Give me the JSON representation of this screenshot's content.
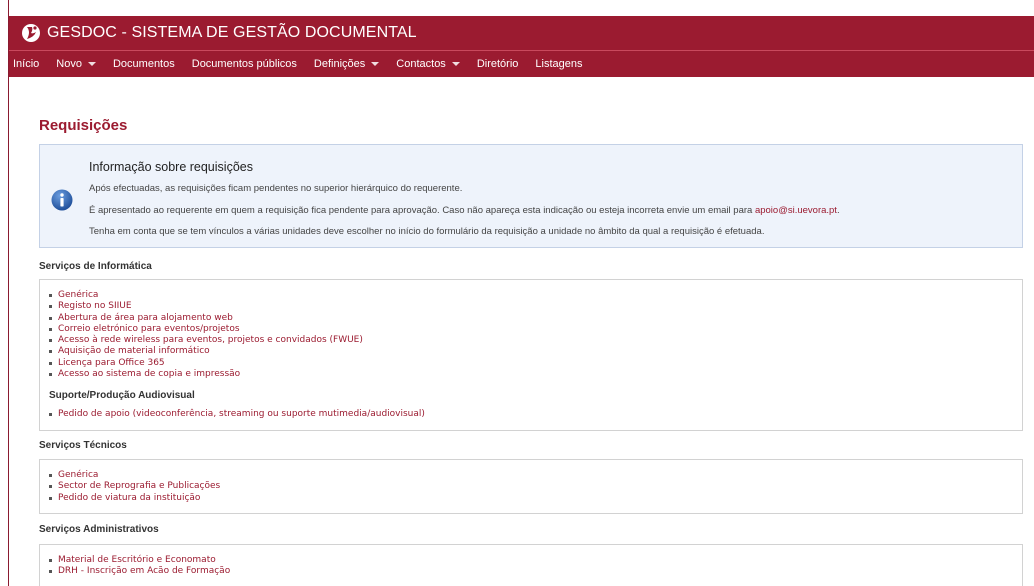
{
  "app": {
    "title": "GESDOC - SISTEMA DE GESTÃO DOCUMENTAL"
  },
  "nav": {
    "items": [
      {
        "label": "Início",
        "dropdown": false
      },
      {
        "label": "Novo",
        "dropdown": true
      },
      {
        "label": "Documentos",
        "dropdown": false
      },
      {
        "label": "Documentos públicos",
        "dropdown": false
      },
      {
        "label": "Definições",
        "dropdown": true
      },
      {
        "label": "Contactos",
        "dropdown": true
      },
      {
        "label": "Diretório",
        "dropdown": false
      },
      {
        "label": "Listagens",
        "dropdown": false
      }
    ]
  },
  "page": {
    "title": "Requisições"
  },
  "info": {
    "title": "Informação sobre requisições",
    "line1": "Após efectuadas, as requisições ficam pendentes no superior hierárquico do requerente.",
    "line2_prefix": "É apresentado ao requerente em quem a requisição fica pendente para aprovação. Caso não apareça esta indicação ou esteja incorreta envie um email para ",
    "line2_link": "apoio@si.uevora.pt",
    "line2_suffix": ".",
    "line3": "Tenha em conta que se tem vínculos a várias unidades deve escolher no início do formulário da requisição a unidade no âmbito da qual a requisição é efetuada."
  },
  "sections": {
    "informatica": {
      "heading": "Serviços de Informática",
      "items": [
        "Genérica",
        "Registo no SIIUE",
        "Abertura de área para alojamento web",
        "Correio eletrónico para eventos/projetos",
        "Acesso à rede wireless para eventos, projetos e convidados (FWUE)",
        "Aquisição de material informático",
        "Licença para Office 365",
        "Acesso ao sistema de copia e impressão"
      ],
      "sub_heading": "Suporte/Produção Audiovisual",
      "sub_items": [
        "Pedido de apoio (videoconferência, streaming ou suporte mutimedia/audiovisual)"
      ]
    },
    "tecnicos": {
      "heading": "Serviços Técnicos",
      "items": [
        "Genérica",
        "Sector de Reprografia e Publicações",
        "Pedido de viatura da instituição"
      ]
    },
    "administrativos": {
      "heading": "Serviços Administrativos",
      "items": [
        "Material de Escritório e Economato",
        "DRH - Inscrição em Acão de Formação"
      ]
    }
  },
  "colors": {
    "brand": "#9b1b30",
    "info_bg": "#eef3fb",
    "info_icon": "#2a5ea8"
  }
}
